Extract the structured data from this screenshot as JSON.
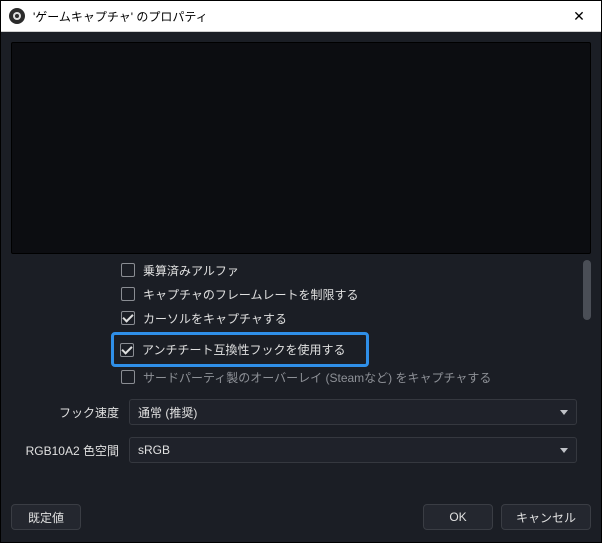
{
  "title": "'ゲームキャプチャ' のプロパティ",
  "checkboxes": {
    "premul_alpha": {
      "label": "乗算済みアルファ",
      "checked": false
    },
    "limit_fps": {
      "label": "キャプチャのフレームレートを制限する",
      "checked": false
    },
    "capture_cursor": {
      "label": "カーソルをキャプチャする",
      "checked": true
    },
    "anticheat": {
      "label": "アンチチート互換性フックを使用する",
      "checked": true
    },
    "overlays": {
      "label": "サードパーティ製のオーバーレイ (Steamなど) をキャプチャする",
      "checked": false
    }
  },
  "fields": {
    "hook_speed": {
      "label": "フック速度",
      "value": "通常 (推奨)"
    },
    "color_space": {
      "label": "RGB10A2 色空間",
      "value": "sRGB"
    }
  },
  "buttons": {
    "defaults": "既定値",
    "ok": "OK",
    "cancel": "キャンセル"
  }
}
